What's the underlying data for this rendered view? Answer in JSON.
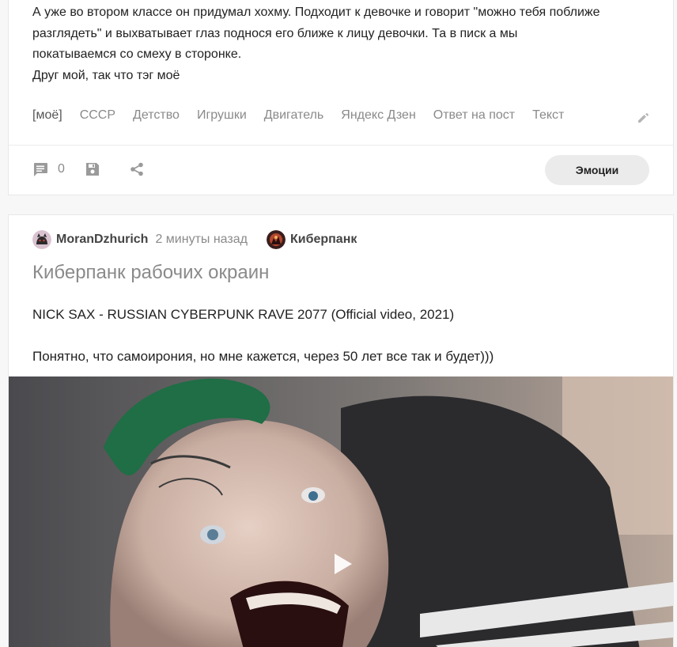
{
  "post1": {
    "text_lines": [
      "А уже во втором классе он придумал хохму. Подходит к девочке и говорит \"можно тебя поближе",
      "разглядеть\" и выхватывает глаз поднося его ближе к лицу девочки. Та в писк а мы",
      "покатываемся со смеху в сторонке.",
      "Друг мой, так что тэг моё"
    ],
    "tags": [
      "[моё]",
      "СССР",
      "Детство",
      "Игрушки",
      "Двигатель",
      "Яндекс Дзен",
      "Ответ на пост",
      "Текст"
    ],
    "comment_count": "0",
    "emotions_label": "Эмоции"
  },
  "post2": {
    "author": "MoranDzhurich",
    "time": "2 минуты назад",
    "community": "Киберпанк",
    "title": "Киберпанк рабочих окраин",
    "body_line1": "NICK SAX - RUSSIAN CYBERPUNK RAVE 2077 (Official video, 2021)",
    "body_line2": "Понятно, что самоирония, но мне кажется,  через 50 лет все так и будет)))"
  },
  "icons": {
    "edit": "pencil-icon",
    "comments": "comment-bubble-icon",
    "save": "floppy-disk-icon",
    "share": "share-icon",
    "play": "play-icon"
  },
  "colors": {
    "tag_text": "#8a8a8a",
    "emotions_bg": "#ebebeb",
    "title_gray": "#8a8a8a"
  }
}
